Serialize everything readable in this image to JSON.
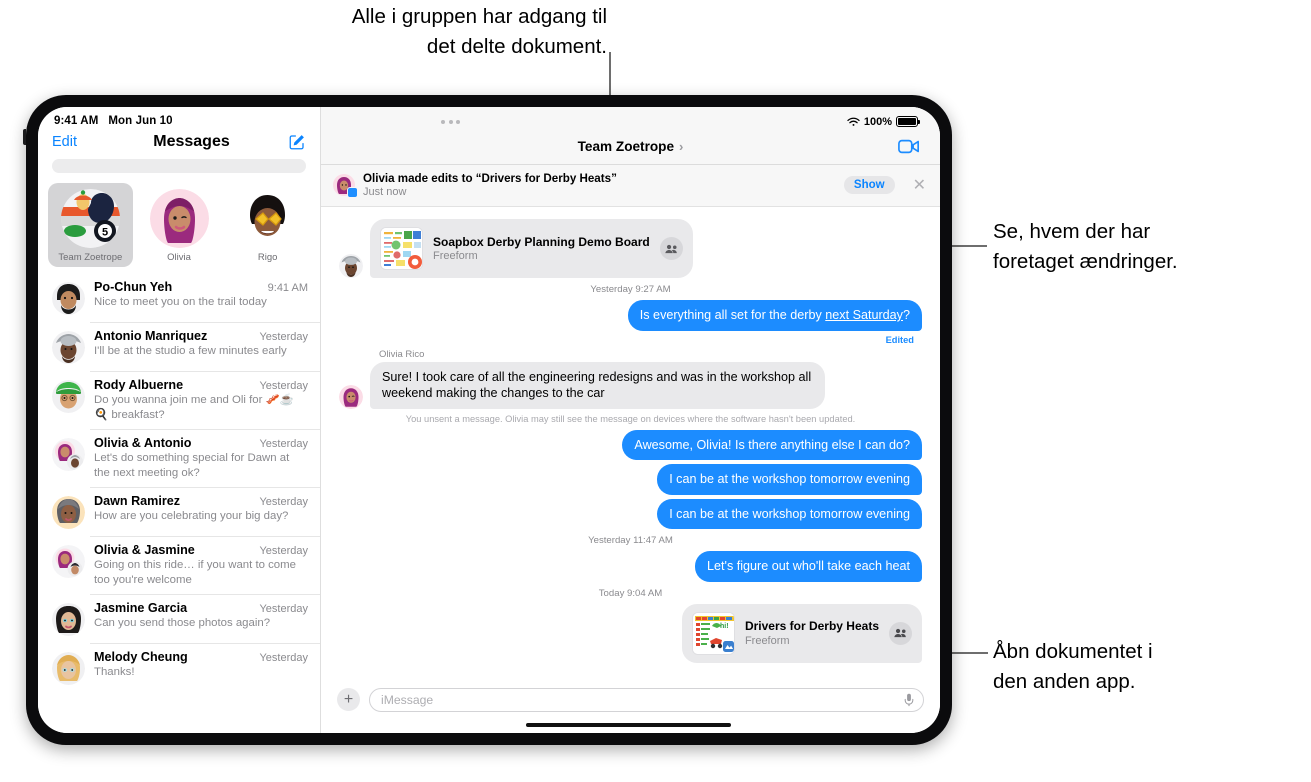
{
  "callouts": {
    "top": "Alle i gruppen har adgang til\ndet delte dokument.",
    "right_top": "Se, hvem der har\nforetaget ændringer.",
    "right_bottom": "Åbn dokumentet i\nden anden app."
  },
  "sidebar": {
    "status_time": "9:41 AM",
    "status_date": "Mon Jun 10",
    "edit_label": "Edit",
    "title": "Messages",
    "compose_icon": "compose-icon",
    "search_placeholder": "",
    "pinned": [
      {
        "label": "Team Zoetrope",
        "selected": true
      },
      {
        "label": "Olivia",
        "selected": false
      },
      {
        "label": "Rigo",
        "selected": false
      }
    ],
    "conversations": [
      {
        "name": "Po-Chun Yeh",
        "time": "9:41 AM",
        "preview": "Nice to meet you on the trail today"
      },
      {
        "name": "Antonio Manriquez",
        "time": "Yesterday",
        "preview": "I'll be at the studio a few minutes early"
      },
      {
        "name": "Rody Albuerne",
        "time": "Yesterday",
        "preview": "Do you wanna join me and Oli for 🥓☕🍳 breakfast?"
      },
      {
        "name": "Olivia & Antonio",
        "time": "Yesterday",
        "preview": "Let's do something special for Dawn at the next meeting ok?"
      },
      {
        "name": "Dawn Ramirez",
        "time": "Yesterday",
        "preview": "How are you celebrating your big day?"
      },
      {
        "name": "Olivia & Jasmine",
        "time": "Yesterday",
        "preview": "Going on this ride… if you want to come too you're welcome"
      },
      {
        "name": "Jasmine Garcia",
        "time": "Yesterday",
        "preview": "Can you send those photos again?"
      },
      {
        "name": "Melody Cheung",
        "time": "Yesterday",
        "preview": "Thanks!"
      }
    ]
  },
  "chat": {
    "status_battery_pct": "100%",
    "wifi_icon": "wifi-icon",
    "more_icon": "more-dots-icon",
    "title": "Team Zoetrope",
    "title_chevron": "›",
    "facetime_icon": "facetime-video-icon",
    "banner": {
      "title": "Olivia made edits to “Drivers for Derby Heats”",
      "subtitle": "Just now",
      "show_label": "Show",
      "close_icon": "close-icon"
    },
    "doc_card_top": {
      "name": "Soapbox Derby Planning Demo Board",
      "app": "Freeform",
      "participants_icon": "people-icon"
    },
    "timestamp_1": "Yesterday 9:27 AM",
    "message_1": "Is everything all set for the derby ",
    "message_1_underlined": "next Saturday",
    "message_1_tail": "?",
    "edited_label": "Edited",
    "sender_olivia": "Olivia Rico",
    "message_2": "Sure! I took care of all the engineering redesigns and was in the workshop all weekend making the changes to the car",
    "unsent_notice": "You unsent a message. Olivia may still see the message on devices where the software hasn't been updated.",
    "message_3": "Awesome, Olivia! Is there anything else I can do?",
    "message_4": "I can be at the workshop tomorrow evening",
    "message_5": "I can be at the workshop tomorrow evening",
    "timestamp_2": "Yesterday 11:47 AM",
    "message_6": "Let's figure out who'll take each heat",
    "timestamp_3": "Today 9:04 AM",
    "doc_card_bottom": {
      "name": "Drivers for Derby Heats",
      "app": "Freeform",
      "participants_icon": "people-icon"
    },
    "composer": {
      "plus_icon": "plus-icon",
      "placeholder": "iMessage",
      "mic_icon": "microphone-icon"
    }
  },
  "colors": {
    "accent_blue": "#1c8cff",
    "link_blue": "#0a84ff",
    "bubble_gray": "#e9e9eb",
    "chrome_gray": "#f7f7f7"
  }
}
